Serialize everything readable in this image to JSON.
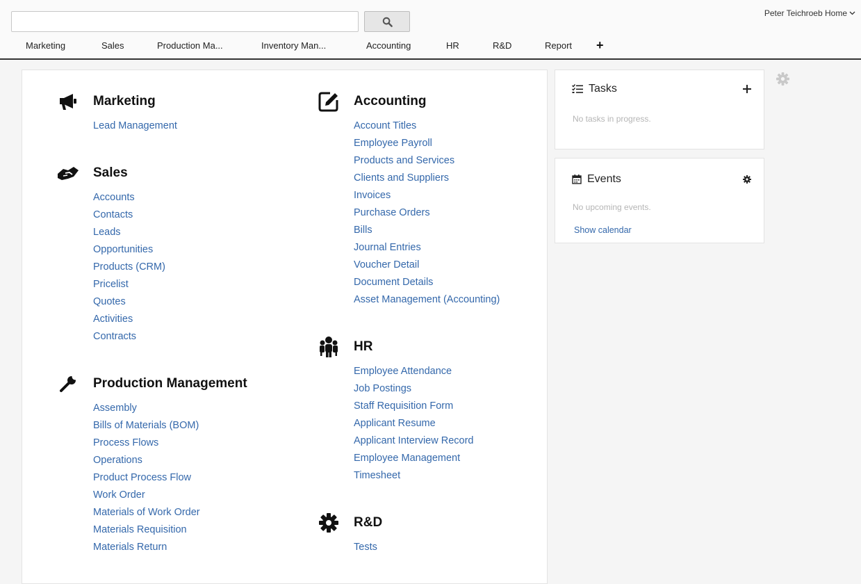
{
  "search": {
    "value": "",
    "placeholder": ""
  },
  "user": {
    "label": "Peter Teichroeb Home"
  },
  "nav": {
    "tabs": [
      {
        "label": "Marketing"
      },
      {
        "label": "Sales"
      },
      {
        "label": "Production Ma..."
      },
      {
        "label": "Inventory Man..."
      },
      {
        "label": "Accounting"
      },
      {
        "label": "HR"
      },
      {
        "label": "R&D"
      },
      {
        "label": "Report"
      }
    ],
    "add_label": "+"
  },
  "modules": {
    "marketing": {
      "title": "Marketing",
      "icon": "megaphone-icon",
      "links": [
        "Lead Management"
      ]
    },
    "sales": {
      "title": "Sales",
      "icon": "handshake-icon",
      "links": [
        "Accounts",
        "Contacts",
        "Leads",
        "Opportunities",
        "Products (CRM)",
        "Pricelist",
        "Quotes",
        "Activities",
        "Contracts"
      ]
    },
    "production": {
      "title": "Production Management",
      "icon": "wrench-icon",
      "links": [
        "Assembly",
        "Bills of Materials (BOM)",
        "Process Flows",
        "Operations",
        "Product Process Flow",
        "Work Order",
        "Materials of Work Order",
        "Materials Requisition",
        "Materials Return"
      ]
    },
    "accounting": {
      "title": "Accounting",
      "icon": "edit-icon",
      "links": [
        "Account Titles",
        "Employee Payroll",
        "Products and Services",
        "Clients and Suppliers",
        "Invoices",
        "Purchase Orders",
        "Bills",
        "Journal Entries",
        "Voucher Detail",
        "Document Details",
        "Asset Management (Accounting)"
      ]
    },
    "hr": {
      "title": "HR",
      "icon": "users-icon",
      "links": [
        "Employee Attendance",
        "Job Postings",
        "Staff Requisition Form",
        "Applicant Resume",
        "Applicant Interview Record",
        "Employee Management",
        "Timesheet"
      ]
    },
    "rnd": {
      "title": "R&D",
      "icon": "gear-icon",
      "links": [
        "Tests"
      ]
    }
  },
  "tasks": {
    "title": "Tasks",
    "empty": "No tasks in progress."
  },
  "events": {
    "title": "Events",
    "empty": "No upcoming events.",
    "calendar_link": "Show calendar"
  },
  "colors": {
    "link": "#3468ab",
    "muted": "#b5b5b5",
    "border": "#333333"
  }
}
